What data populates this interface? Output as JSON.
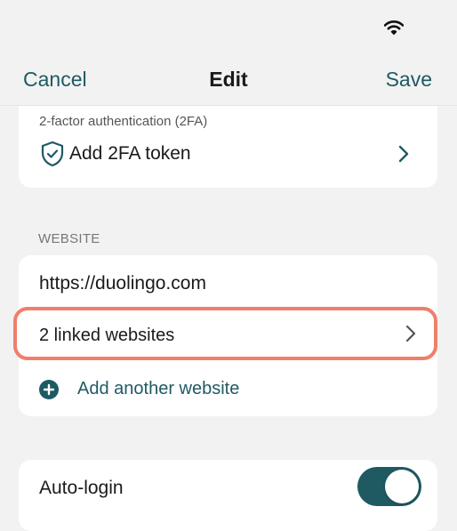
{
  "nav": {
    "cancel_label": "Cancel",
    "title": "Edit",
    "save_label": "Save"
  },
  "two_factor": {
    "caption": "2-factor authentication (2FA)",
    "add_label": "Add 2FA token",
    "icon": "shield-check-icon"
  },
  "website": {
    "section_header": "WEBSITE",
    "url": "https://duolingo.com",
    "linked_label": "2 linked websites",
    "add_label": "Add another website",
    "add_icon": "plus-circle-icon"
  },
  "auto_login": {
    "label": "Auto-login",
    "enabled": true
  },
  "colors": {
    "accent": "#1f5a63",
    "highlight": "#ef7f6a",
    "background": "#f2f2f2",
    "card": "#ffffff"
  }
}
